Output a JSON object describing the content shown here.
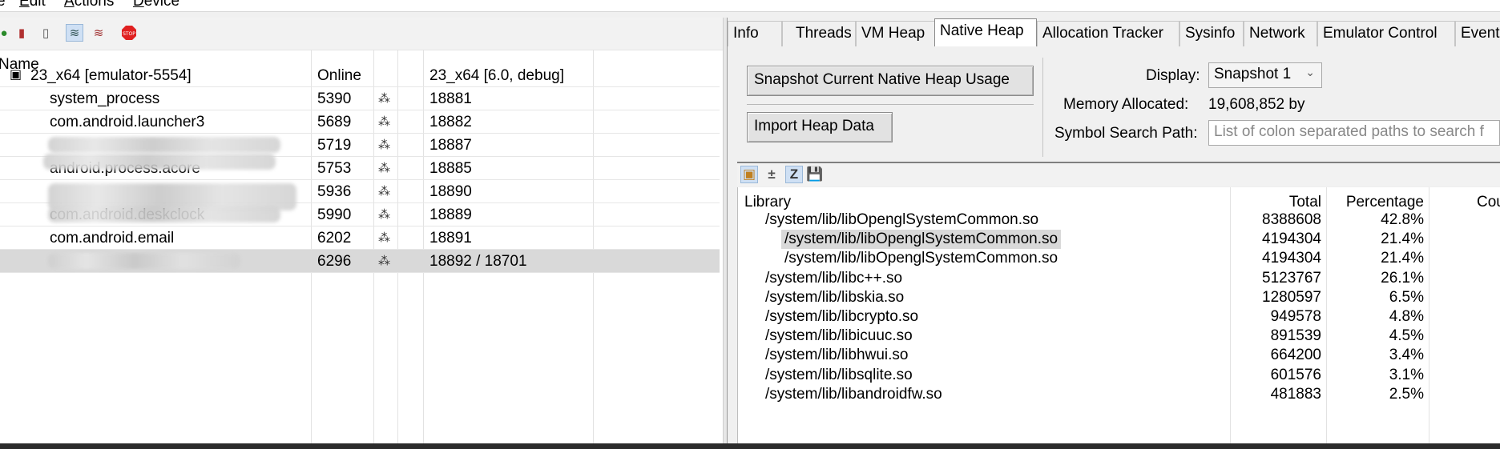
{
  "menu": {
    "items": [
      {
        "label": "File",
        "u": ""
      },
      {
        "label": "Edit",
        "u": "E"
      },
      {
        "label": "Actions",
        "u": "A"
      },
      {
        "label": "Device",
        "u": "D"
      }
    ]
  },
  "device_toolbar": {
    "icons": [
      "debug-process-icon",
      "update-heap-icon",
      "dump-hprof-icon",
      "update-threads-icon",
      "start-method-profiling-icon",
      "stop-process-icon"
    ]
  },
  "devices": {
    "columns": [
      "Name",
      "",
      "",
      "",
      ""
    ],
    "device": {
      "name": "23_x64 [emulator-5554]",
      "status": "Online",
      "info": "23_x64 [6.0, debug]"
    },
    "processes": [
      {
        "name": "system_process",
        "pid": "5390",
        "ports": "18881",
        "blurred": false
      },
      {
        "name": "com.android.launcher3",
        "pid": "5689",
        "ports": "18882",
        "blurred": false
      },
      {
        "name": "",
        "pid": "5719",
        "ports": "18887",
        "blurred": true
      },
      {
        "name": "android.process.acore",
        "pid": "5753",
        "ports": "18885",
        "blurred": true
      },
      {
        "name": "",
        "pid": "5936",
        "ports": "18890",
        "blurred": true
      },
      {
        "name": "com.android.deskclock",
        "pid": "5990",
        "ports": "18889",
        "blurred": true
      },
      {
        "name": "com.android.email",
        "pid": "6202",
        "ports": "18891",
        "blurred": false
      },
      {
        "name": "",
        "pid": "6296",
        "ports": "18892 / 18701",
        "blurred": true
      }
    ]
  },
  "tabs": [
    "Info",
    "Threads",
    "VM Heap",
    "Native Heap",
    "Allocation Tracker",
    "Sysinfo",
    "Network",
    "Emulator Control",
    "Event"
  ],
  "active_tab": "Native Heap",
  "native_heap": {
    "snapshot_button": "Snapshot Current Native Heap Usage",
    "import_button": "Import Heap Data",
    "display_label": "Display:",
    "display_value": "Snapshot 1",
    "memory_label": "Memory Allocated:",
    "memory_value": "19,608,852 by",
    "symbol_label": "Symbol Search Path:",
    "symbol_placeholder": "List of colon separated paths to search f",
    "lib_columns": {
      "library": "Library",
      "total": "Total",
      "percentage": "Percentage",
      "count": "Cou"
    },
    "rows": [
      {
        "library": "/system/lib/libOpenglSystemCommon.so",
        "total": "8388608",
        "pct": "42.8%",
        "indent": 1,
        "selected": false
      },
      {
        "library": "/system/lib/libOpenglSystemCommon.so",
        "total": "4194304",
        "pct": "21.4%",
        "indent": 2,
        "selected": true
      },
      {
        "library": "/system/lib/libOpenglSystemCommon.so",
        "total": "4194304",
        "pct": "21.4%",
        "indent": 2,
        "selected": false
      },
      {
        "library": "/system/lib/libc++.so",
        "total": "5123767",
        "pct": "26.1%",
        "indent": 1,
        "selected": false
      },
      {
        "library": "/system/lib/libskia.so",
        "total": "1280597",
        "pct": "6.5%",
        "indent": 1,
        "selected": false
      },
      {
        "library": "/system/lib/libcrypto.so",
        "total": "949578",
        "pct": "4.8%",
        "indent": 1,
        "selected": false
      },
      {
        "library": "/system/lib/libicuuc.so",
        "total": "891539",
        "pct": "4.5%",
        "indent": 1,
        "selected": false
      },
      {
        "library": "/system/lib/libhwui.so",
        "total": "664200",
        "pct": "3.4%",
        "indent": 1,
        "selected": false
      },
      {
        "library": "/system/lib/libsqlite.so",
        "total": "601576",
        "pct": "3.1%",
        "indent": 1,
        "selected": false
      },
      {
        "library": "/system/lib/libandroidfw.so",
        "total": "481883",
        "pct": "2.5%",
        "indent": 1,
        "selected": false
      }
    ]
  }
}
